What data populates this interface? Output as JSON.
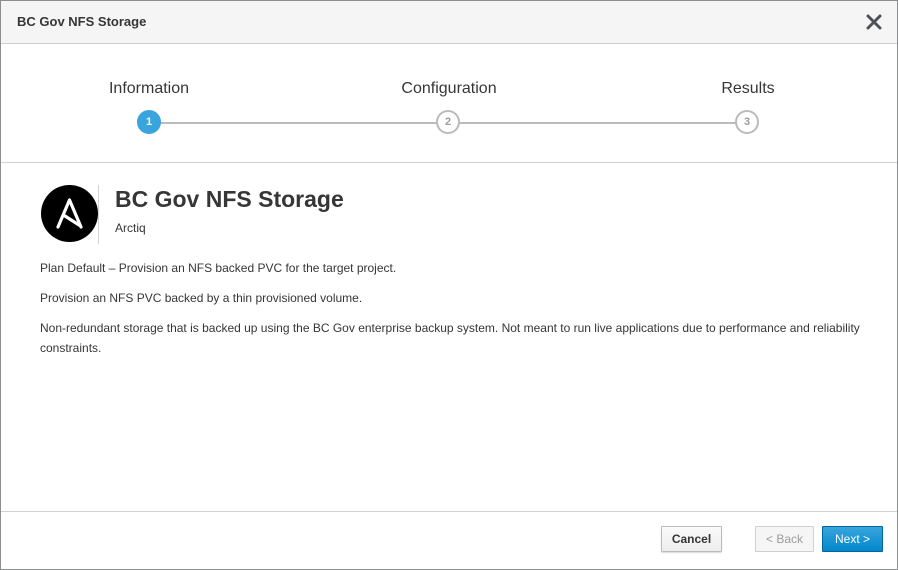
{
  "dialog": {
    "title": "BC Gov NFS Storage",
    "close_icon": "close-icon"
  },
  "wizard": {
    "steps": [
      {
        "label": "Information",
        "number": "1",
        "state": "active"
      },
      {
        "label": "Configuration",
        "number": "2",
        "state": "inactive"
      },
      {
        "label": "Results",
        "number": "3",
        "state": "inactive"
      }
    ],
    "colors": {
      "active": "#39a5dc",
      "inactive": "#bbbbbb"
    }
  },
  "service": {
    "logo_icon": "ansible-logo-icon",
    "title": "BC Gov NFS Storage",
    "provider": "Arctiq",
    "descriptions": [
      "Plan Default – Provision an NFS backed PVC for the target project.",
      "Provision an NFS PVC backed by a thin provisioned volume.",
      "Non-redundant storage that is backed up using the BC Gov enterprise backup system.  Not meant to run live applications due to performance and reliability constraints."
    ]
  },
  "footer": {
    "cancel_label": "Cancel",
    "back_label": "< Back",
    "next_label": "Next >",
    "colors": {
      "primary": "#0088ce"
    }
  }
}
